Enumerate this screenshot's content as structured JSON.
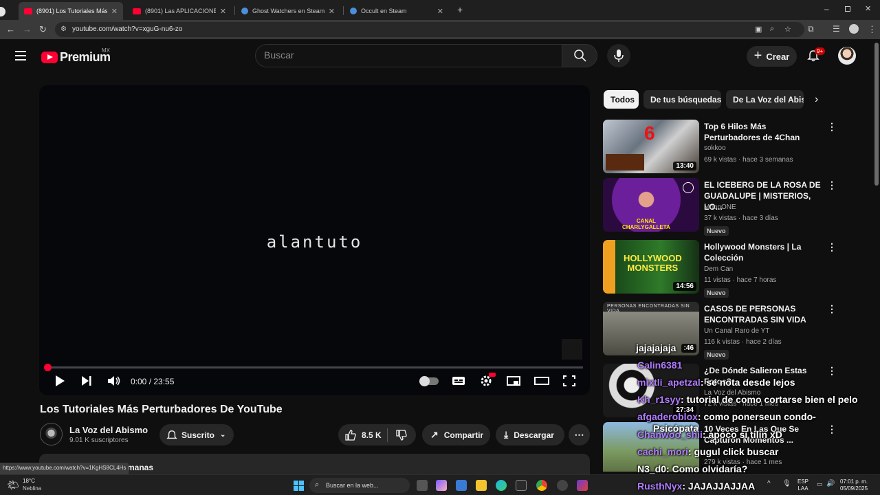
{
  "browser": {
    "tabs": [
      {
        "title": "(8901) Los Tutoriales Más Perturba",
        "favicon": "youtube-icon",
        "active": true
      },
      {
        "title": "(8901) Las APLICACIONES más",
        "favicon": "youtube-icon",
        "active": false
      },
      {
        "title": "Ghost Watchers en Steam",
        "favicon": "steam-icon",
        "active": false
      },
      {
        "title": "Occult en Steam",
        "favicon": "steam-icon",
        "active": false
      }
    ],
    "url": "youtube.com/watch?v=xguG-nu6-zo",
    "status_url": "https://www.youtube.com/watch?v=1KgHS8CL4Hs"
  },
  "header": {
    "logo_text": "Premium",
    "country_code": "MX",
    "search_placeholder": "Buscar",
    "create_label": "Crear",
    "notification_badge": "9+"
  },
  "player": {
    "overlay_text": "alantuto",
    "time": "0:00 / 23:55",
    "progress": 0.0
  },
  "video": {
    "title": "Los Tutoriales Más Perturbadores De YouTube",
    "channel": "La Voz del Abismo",
    "subscribers": "9.01 K suscriptores",
    "subscribe_label": "Suscrito",
    "likes": "8.5 K",
    "share_label": "Compartir",
    "download_label": "Descargar",
    "description_snippet": "manas"
  },
  "chips": [
    {
      "label": "Todos",
      "selected": true
    },
    {
      "label": "De tus búsquedas",
      "selected": false
    },
    {
      "label": "De La Voz del Abismo",
      "selected": false
    }
  ],
  "recommendations": [
    {
      "title": "Top 6 Hilos Más Perturbadores de 4Chan",
      "channel": "sokkoo",
      "meta": "69 k vistas · hace 3 semanas",
      "duration": "13:40",
      "new": false
    },
    {
      "title": "EL ICEBERG DE LA ROSA DE GUADALUPE | MISTERIOS, LO...",
      "channel": "MoonONE",
      "meta": "37 k vistas · hace 3 días",
      "duration": "",
      "new": true
    },
    {
      "title": "Hollywood Monsters | La Colección",
      "channel": "Dem Can",
      "meta": "11 vistas · hace 7 horas",
      "duration": "14:56",
      "new": true
    },
    {
      "title": "CASOS DE PERSONAS ENCONTRADAS SIN VIDA",
      "channel": "Un Canal Raro de YT",
      "meta": "116 k vistas · hace 2 días",
      "duration": ":46",
      "new": true
    },
    {
      "title": "¿De Dónde Salieron Estas Fotos?",
      "channel": "La Voz del Abismo",
      "meta": "72 k vistas · hace 1 mes",
      "duration": "27:34",
      "new": false
    },
    {
      "title": "10 Veces En Las Que Se Capturon Momentos ...",
      "channel": "",
      "meta": "279 k vistas · hace 1 mes",
      "duration": "",
      "new": false
    }
  ],
  "chat": [
    {
      "user": "Calin6381",
      "message": ""
    },
    {
      "user": "mixtli_apetzal",
      "message": ": se nota desde lejos"
    },
    {
      "user": "Kh_r1syy",
      "message": ": tutorial de como cortarse bien el pelo"
    },
    {
      "user": "afgaderoblox",
      "message": ": como ponerseun condo-"
    },
    {
      "user": "Psicópata",
      "message": ""
    },
    {
      "user": "Chanwoo_shii",
      "message": ": apoco si tilin xD"
    },
    {
      "user": "cachi_mori",
      "message": ": gugul click buscar"
    },
    {
      "user": "N3_d0",
      "message": ": Como olvidaría?"
    },
    {
      "user": "RusthNyx",
      "message": ": JAJAJJAJJAA"
    },
    {
      "user": "jajajajaja",
      "message": ""
    }
  ],
  "taskbar": {
    "temperature": "18°C",
    "weather": "Neblina",
    "search_placeholder": "Buscar en la web...",
    "lang_top": "ESP",
    "lang_bottom": "LAA",
    "time": "07:01 p. m.",
    "date": "05/09/2025"
  },
  "colors": {
    "youtube_red": "#ff0033",
    "background": "#0f0f0f",
    "chat_username": "#b07cff"
  }
}
